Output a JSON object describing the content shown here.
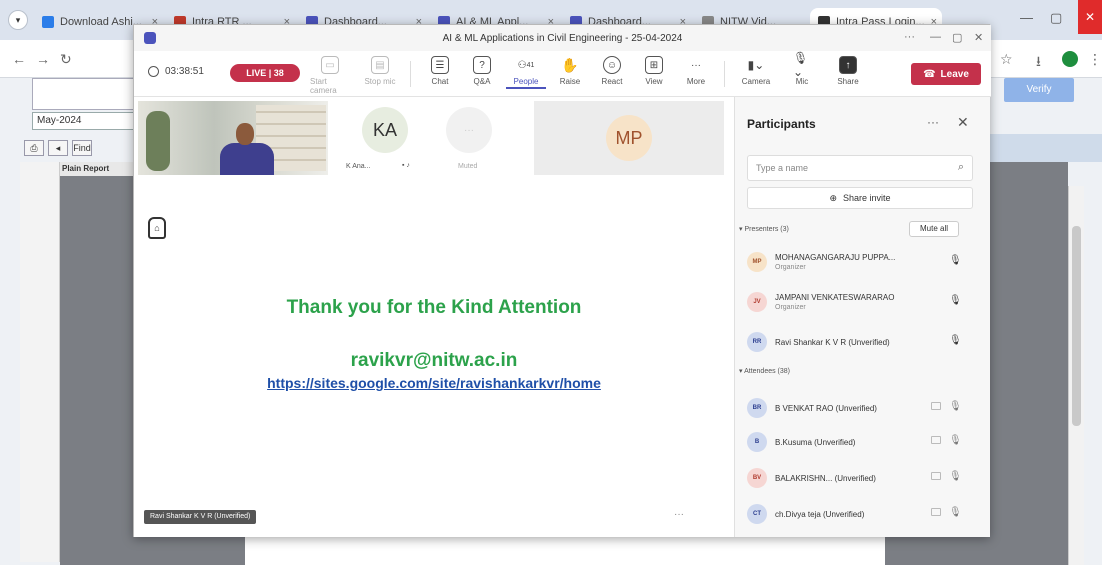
{
  "browser": {
    "tabs": [
      {
        "label": "Download Ashi..."
      },
      {
        "label": "Intra RTR ..."
      },
      {
        "label": "Dashboard..."
      },
      {
        "label": "AI & ML Appl..."
      },
      {
        "label": "Dashboard..."
      },
      {
        "label": "NITW Vid..."
      },
      {
        "label": "Intra Pass Login..."
      }
    ]
  },
  "doc": {
    "date": "May-2024",
    "header_cell": "Plain Report",
    "toolbar_find": "Find",
    "right_button": "Verify"
  },
  "teams": {
    "window_title": "AI & ML Applications in Civil Engineering - 25-04-2024",
    "timer": "03:38:51",
    "live_badge": "LIVE | 38",
    "toolbar": [
      {
        "label": "Start camera",
        "icon": "camera-icon",
        "dim": true
      },
      {
        "label": "Stop mic",
        "icon": "mic-icon",
        "dim": true
      },
      {
        "label": "Chat",
        "icon": "chat-icon"
      },
      {
        "label": "Q&A",
        "icon": "qa-icon"
      },
      {
        "label": "People",
        "icon": "people-icon",
        "badge": "41",
        "active": true
      },
      {
        "label": "Raise",
        "icon": "hand-icon"
      },
      {
        "label": "React",
        "icon": "smile-icon"
      },
      {
        "label": "View",
        "icon": "grid-icon"
      },
      {
        "label": "More",
        "icon": "more-icon"
      },
      {
        "label": "Camera",
        "icon": "camera-off-icon"
      },
      {
        "label": "Mic",
        "icon": "mic-off-icon"
      },
      {
        "label": "Share",
        "icon": "share-icon"
      }
    ],
    "leave_label": "Leave",
    "tiles": {
      "ka_initials": "KA",
      "ka_name": "K Ana...",
      "other_name": "Muted",
      "mp_initials": "MP"
    },
    "slide": {
      "title": "Thank you for the Kind Attention",
      "email": "ravikvr@nitw.ac.in",
      "url": "https://sites.google.com/site/ravishankarkvr/home"
    },
    "presenter_tag": "Ravi Shankar K V R (Unverified)",
    "panel": {
      "title": "Participants",
      "search_placeholder": "Type a name",
      "share_invite": "Share invite",
      "presenters_label": "Presenters (3)",
      "mute_all": "Mute all",
      "attendees_label": "Attendees (38)",
      "presenters": [
        {
          "initials": "MP",
          "name": "MOHANAGANGARAJU PUPPA...",
          "role": "Organizer",
          "color": "#f7e3c8",
          "text": "#a0522d"
        },
        {
          "initials": "JV",
          "name": "JAMPANI VENKATESWARARAO",
          "role": "Organizer",
          "color": "#f6d6d3",
          "text": "#b03a2e"
        },
        {
          "initials": "RR",
          "name": "Ravi Shankar K V R (Unverified)",
          "role": "",
          "color": "#cfd9ef",
          "text": "#2c3e8f"
        }
      ],
      "attendees": [
        {
          "initials": "BR",
          "name": "B VENKAT RAO (Unverified)",
          "color": "#cfd9ef",
          "text": "#2c3e8f"
        },
        {
          "initials": "B",
          "name": "B.Kusuma (Unverified)",
          "color": "#cfd9ef",
          "text": "#2c3e8f"
        },
        {
          "initials": "BV",
          "name": "BALAKRISHN... (Unverified)",
          "color": "#f6d6d3",
          "text": "#b03a2e"
        },
        {
          "initials": "CT",
          "name": "ch.Divya teja (Unverified)",
          "color": "#cfd9ef",
          "text": "#2c3e8f"
        }
      ]
    }
  }
}
